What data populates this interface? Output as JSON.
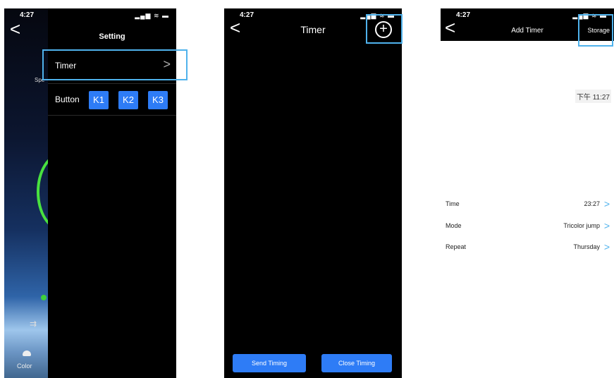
{
  "status_time": "4:27",
  "status_icons": "▂▄▆ ≋ ▬",
  "screen1": {
    "title": "Setting",
    "bg_speed_label": "Spe",
    "bg_color_label": "Color",
    "timer_label": "Timer",
    "button_label": "Button",
    "keys": [
      "K1",
      "K2",
      "K3"
    ]
  },
  "screen2": {
    "title": "Timer",
    "send_button": "Send Timing",
    "close_button": "Close Timing"
  },
  "screen3": {
    "title": "Add Timer",
    "storage_button": "Storage",
    "date_display": "下午 11:27",
    "rows": [
      {
        "label": "Time",
        "value": "23:27"
      },
      {
        "label": "Mode",
        "value": "Tricolor jump"
      },
      {
        "label": "Repeat",
        "value": "Thursday"
      }
    ]
  },
  "colors": {
    "accent_blue": "#2e7cf6",
    "highlight_box": "#4fb2ec",
    "ring_green": "#49e23f"
  }
}
